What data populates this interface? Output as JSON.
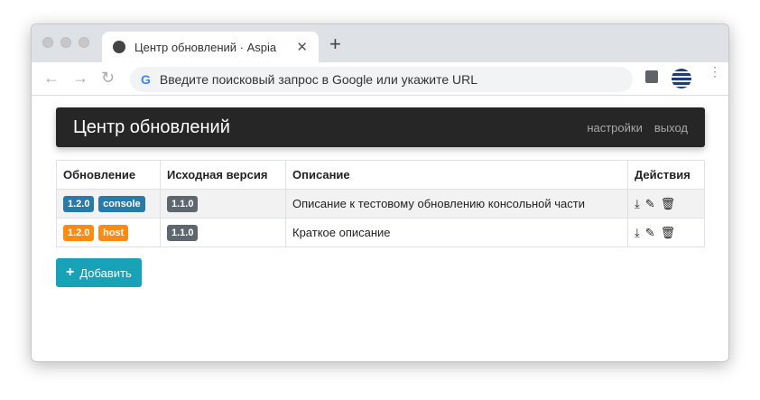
{
  "browser": {
    "tab_title": "Центр обновлений · Aspia",
    "omnibox_placeholder": "Введите поисковый запрос в Google или укажите URL",
    "close": "✕",
    "new_tab": "+",
    "back": "←",
    "forward": "→",
    "reload": "↻",
    "google": "G",
    "menu": "⋮"
  },
  "navbar": {
    "brand": "Центр обновлений",
    "links": [
      "настройки",
      "выход"
    ]
  },
  "table": {
    "headers": [
      "Обновление",
      "Исходная версия",
      "Описание",
      "Действия"
    ],
    "rows": [
      {
        "version": "1.2.0",
        "target": "console",
        "color": "#2a7aa8",
        "source": "1.1.0",
        "description": "Описание к тестовому обновлению консольной части"
      },
      {
        "version": "1.2.0",
        "target": "host",
        "color": "#fd8a14",
        "source": "1.1.0",
        "description": "Краткое описание"
      }
    ],
    "action_icons": {
      "download": "⤓",
      "edit": "✎",
      "delete": "🗑"
    }
  },
  "add_button": {
    "icon": "+",
    "label": "Добавить"
  }
}
